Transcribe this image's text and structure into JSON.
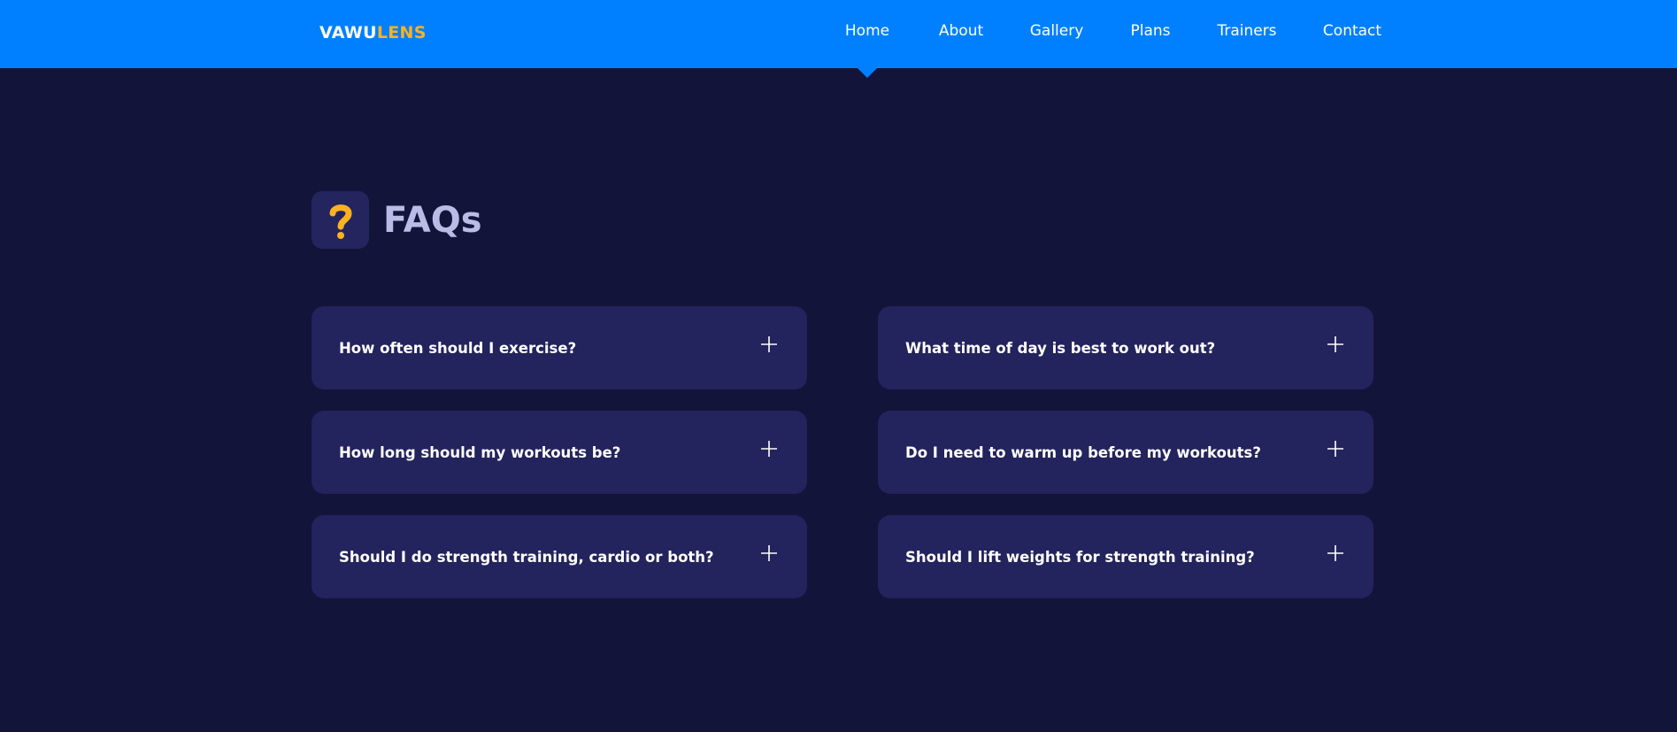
{
  "header": {
    "logo": {
      "primary": "VAWU",
      "accent": "LENS"
    },
    "nav": [
      {
        "label": "Home",
        "active": true
      },
      {
        "label": "About",
        "active": false
      },
      {
        "label": "Gallery",
        "active": false
      },
      {
        "label": "Plans",
        "active": false
      },
      {
        "label": "Trainers",
        "active": false
      },
      {
        "label": "Contact",
        "active": false
      }
    ]
  },
  "faq": {
    "badge_icon": "question-mark-icon",
    "badge_glyph": "?",
    "title": "FAQs",
    "items": [
      {
        "question": "How often should I exercise?",
        "icon": "plus-icon"
      },
      {
        "question": "What time of day is best to work out?",
        "icon": "plus-icon"
      },
      {
        "question": "How long should my workouts be?",
        "icon": "plus-icon"
      },
      {
        "question": "Do I need to warm up before my workouts?",
        "icon": "plus-icon"
      },
      {
        "question": "Should I do strength training, cardio or both?",
        "icon": "plus-icon"
      },
      {
        "question": "Should I lift weights for strength training?",
        "icon": "plus-icon"
      }
    ]
  },
  "colors": {
    "header_bg": "#0080ff",
    "page_bg": "#13143a",
    "card_bg": "#23235d",
    "accent": "#ffb11f",
    "title": "#b9bce6",
    "text": "#ffffff"
  }
}
